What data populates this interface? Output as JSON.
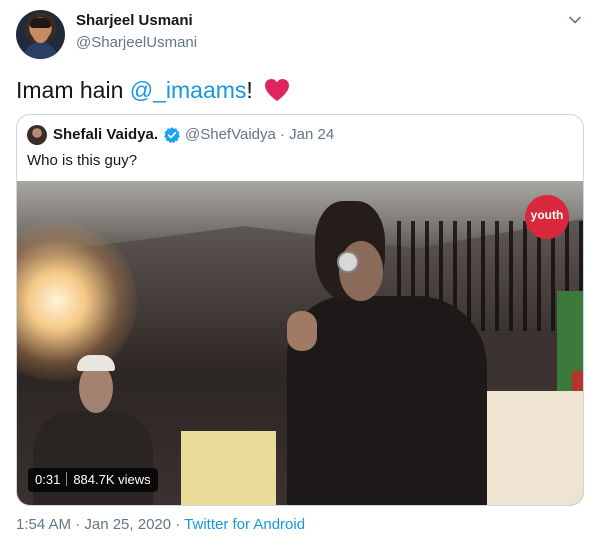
{
  "tweet": {
    "author_name": "Sharjeel Usmani",
    "author_handle": "@SharjeelUsmani",
    "text_before": "Imam hain ",
    "mention": "@_imaams",
    "text_after": "!",
    "heart_color": "#e0245e",
    "menu_icon": "chevron-down-icon"
  },
  "quote": {
    "author_name": "Shefali Vaidya.",
    "verified_icon": "verified-badge-icon",
    "handle_date": "@ShefVaidya · Jan 24",
    "text": "Who is this guy?",
    "video": {
      "duration": "0:31",
      "views": "884.7K views",
      "badge_text": "youth"
    }
  },
  "footer": {
    "timestamp": "1:54 AM · Jan 25, 2020 · ",
    "source": "Twitter for Android"
  },
  "colors": {
    "link": "#1b95e0",
    "secondary_text": "#657786",
    "border": "#ccd6dd",
    "badge": "#d9273b"
  }
}
